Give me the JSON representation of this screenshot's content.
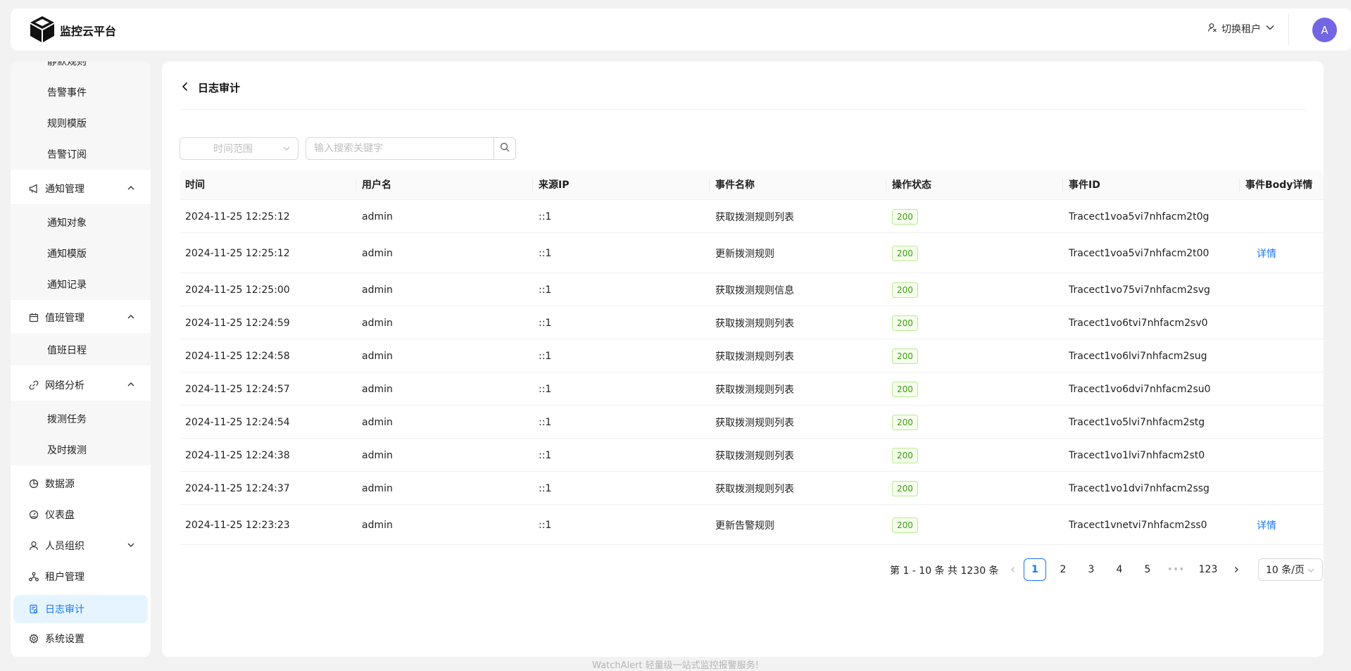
{
  "header": {
    "app_title": "监控云平台",
    "tenant_switch_label": "切换租户",
    "avatar_initial": "A",
    "avatar_color": "#7265e6"
  },
  "sidebar": {
    "items": [
      {
        "label": "静默规则",
        "type": "sub"
      },
      {
        "label": "告警事件",
        "type": "sub"
      },
      {
        "label": "规则模版",
        "type": "sub"
      },
      {
        "label": "告警订阅",
        "type": "sub"
      },
      {
        "label": "通知管理",
        "type": "group",
        "icon": "megaphone-icon",
        "expanded": true
      },
      {
        "label": "通知对象",
        "type": "sub"
      },
      {
        "label": "通知模版",
        "type": "sub"
      },
      {
        "label": "通知记录",
        "type": "sub"
      },
      {
        "label": "值班管理",
        "type": "group",
        "icon": "calendar-icon",
        "expanded": true
      },
      {
        "label": "值班日程",
        "type": "sub"
      },
      {
        "label": "网络分析",
        "type": "group",
        "icon": "link-icon",
        "expanded": true
      },
      {
        "label": "拨测任务",
        "type": "sub"
      },
      {
        "label": "及时拨测",
        "type": "sub"
      },
      {
        "label": "数据源",
        "type": "top",
        "icon": "pie-chart-icon"
      },
      {
        "label": "仪表盘",
        "type": "top",
        "icon": "dashboard-icon"
      },
      {
        "label": "人员组织",
        "type": "group",
        "icon": "user-icon",
        "expanded": false
      },
      {
        "label": "租户管理",
        "type": "top",
        "icon": "cluster-icon"
      },
      {
        "label": "日志审计",
        "type": "top",
        "icon": "audit-icon",
        "active": true
      },
      {
        "label": "系统设置",
        "type": "top",
        "icon": "gear-icon"
      }
    ]
  },
  "main": {
    "title": "日志审计",
    "filters": {
      "range_placeholder": "时间范围",
      "search_placeholder": "输入搜索关键字"
    },
    "table": {
      "columns": [
        "时间",
        "用户名",
        "来源IP",
        "事件名称",
        "操作状态",
        "事件ID",
        "事件Body详情"
      ],
      "rows": [
        {
          "time": "2024-11-25 12:25:12",
          "user": "admin",
          "ip": "::1",
          "event": "获取拨测规则列表",
          "status": "200",
          "id": "Tracect1voa5vi7nhfacm2t0g",
          "detail": ""
        },
        {
          "time": "2024-11-25 12:25:12",
          "user": "admin",
          "ip": "::1",
          "event": "更新拨测规则",
          "status": "200",
          "id": "Tracect1voa5vi7nhfacm2t00",
          "detail": "详情"
        },
        {
          "time": "2024-11-25 12:25:00",
          "user": "admin",
          "ip": "::1",
          "event": "获取拨测规则信息",
          "status": "200",
          "id": "Tracect1vo75vi7nhfacm2svg",
          "detail": ""
        },
        {
          "time": "2024-11-25 12:24:59",
          "user": "admin",
          "ip": "::1",
          "event": "获取拨测规则列表",
          "status": "200",
          "id": "Tracect1vo6tvi7nhfacm2sv0",
          "detail": ""
        },
        {
          "time": "2024-11-25 12:24:58",
          "user": "admin",
          "ip": "::1",
          "event": "获取拨测规则列表",
          "status": "200",
          "id": "Tracect1vo6lvi7nhfacm2sug",
          "detail": ""
        },
        {
          "time": "2024-11-25 12:24:57",
          "user": "admin",
          "ip": "::1",
          "event": "获取拨测规则列表",
          "status": "200",
          "id": "Tracect1vo6dvi7nhfacm2su0",
          "detail": ""
        },
        {
          "time": "2024-11-25 12:24:54",
          "user": "admin",
          "ip": "::1",
          "event": "获取拨测规则列表",
          "status": "200",
          "id": "Tracect1vo5lvi7nhfacm2stg",
          "detail": ""
        },
        {
          "time": "2024-11-25 12:24:38",
          "user": "admin",
          "ip": "::1",
          "event": "获取拨测规则列表",
          "status": "200",
          "id": "Tracect1vo1lvi7nhfacm2st0",
          "detail": ""
        },
        {
          "time": "2024-11-25 12:24:37",
          "user": "admin",
          "ip": "::1",
          "event": "获取拨测规则列表",
          "status": "200",
          "id": "Tracect1vo1dvi7nhfacm2ssg",
          "detail": ""
        },
        {
          "time": "2024-11-25 12:23:23",
          "user": "admin",
          "ip": "::1",
          "event": "更新告警规则",
          "status": "200",
          "id": "Tracect1vnetvi7nhfacm2ss0",
          "detail": "详情"
        }
      ]
    },
    "pagination": {
      "total_text": "第 1 - 10 条 共 1230 条",
      "pages": [
        "1",
        "2",
        "3",
        "4",
        "5",
        "•••",
        "123"
      ],
      "current": "1",
      "page_size": "10 条/页"
    }
  },
  "footer": {
    "text": "WatchAlert 轻量级一站式监控报警服务!"
  },
  "colors": {
    "accent": "#1677ff",
    "active_bg": "#e6f4ff",
    "status_tag": "#389e0d"
  }
}
